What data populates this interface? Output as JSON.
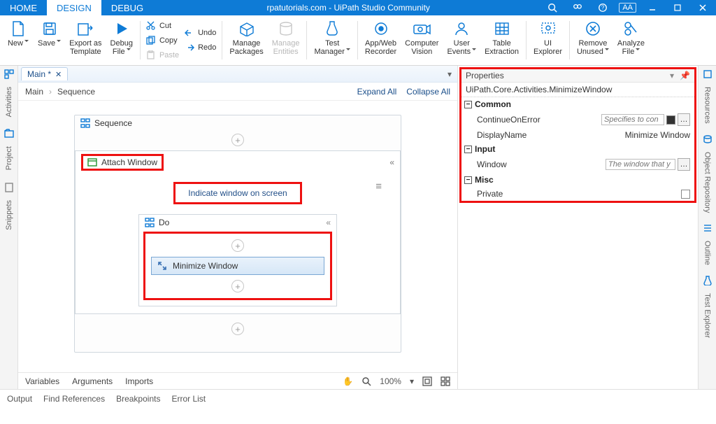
{
  "titlebar": {
    "tabs": [
      "HOME",
      "DESIGN",
      "DEBUG"
    ],
    "active_tab": 1,
    "title": "rpatutorials.com - UiPath Studio Community",
    "aa": "AA"
  },
  "ribbon": {
    "new": "New",
    "save": "Save",
    "export": "Export as\nTemplate",
    "debug": "Debug\nFile",
    "cut": "Cut",
    "copy": "Copy",
    "paste": "Paste",
    "undo": "Undo",
    "redo": "Redo",
    "manage_packages": "Manage\nPackages",
    "manage_entities": "Manage\nEntities",
    "test_manager": "Test\nManager",
    "app_web": "App/Web\nRecorder",
    "computer_vision": "Computer\nVision",
    "user_events": "User\nEvents",
    "table_extraction": "Table\nExtraction",
    "ui_explorer": "UI\nExplorer",
    "remove_unused": "Remove\nUnused",
    "analyze_file": "Analyze\nFile"
  },
  "left_rail": {
    "activities": "Activities",
    "project": "Project",
    "snippets": "Snippets"
  },
  "doc_tab": "Main *",
  "breadcrumb": {
    "root": "Main",
    "leaf": "Sequence",
    "expand": "Expand All",
    "collapse": "Collapse All"
  },
  "workflow": {
    "sequence": "Sequence",
    "attach": "Attach Window",
    "indicate": "Indicate window on screen",
    "do": "Do",
    "minimize": "Minimize Window"
  },
  "bottom_tabs": {
    "variables": "Variables",
    "arguments": "Arguments",
    "imports": "Imports",
    "zoom": "100%"
  },
  "properties": {
    "title": "Properties",
    "class": "UiPath.Core.Activities.MinimizeWindow",
    "groups": {
      "common": "Common",
      "input": "Input",
      "misc": "Misc"
    },
    "continue_on_error": {
      "label": "ContinueOnError",
      "placeholder": "Specifies to con"
    },
    "display_name": {
      "label": "DisplayName",
      "value": "Minimize Window"
    },
    "window": {
      "label": "Window",
      "placeholder": "The window that y"
    },
    "private": {
      "label": "Private"
    }
  },
  "right_rail": {
    "resources": "Resources",
    "object_repo": "Object Repository",
    "outline": "Outline",
    "test_explorer": "Test Explorer"
  },
  "statusbar": {
    "output": "Output",
    "find_refs": "Find References",
    "breakpoints": "Breakpoints",
    "error_list": "Error List"
  }
}
